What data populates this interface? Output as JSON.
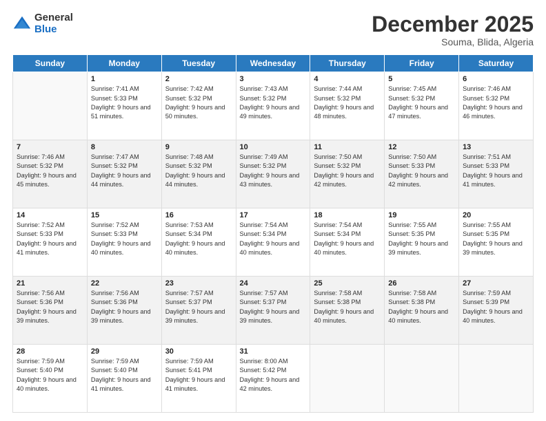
{
  "header": {
    "logo_general": "General",
    "logo_blue": "Blue",
    "main_title": "December 2025",
    "subtitle": "Souma, Blida, Algeria"
  },
  "weekdays": [
    "Sunday",
    "Monday",
    "Tuesday",
    "Wednesday",
    "Thursday",
    "Friday",
    "Saturday"
  ],
  "weeks": [
    [
      {
        "day": "",
        "sunrise": "",
        "sunset": "",
        "daylight": ""
      },
      {
        "day": "1",
        "sunrise": "Sunrise: 7:41 AM",
        "sunset": "Sunset: 5:33 PM",
        "daylight": "Daylight: 9 hours and 51 minutes."
      },
      {
        "day": "2",
        "sunrise": "Sunrise: 7:42 AM",
        "sunset": "Sunset: 5:32 PM",
        "daylight": "Daylight: 9 hours and 50 minutes."
      },
      {
        "day": "3",
        "sunrise": "Sunrise: 7:43 AM",
        "sunset": "Sunset: 5:32 PM",
        "daylight": "Daylight: 9 hours and 49 minutes."
      },
      {
        "day": "4",
        "sunrise": "Sunrise: 7:44 AM",
        "sunset": "Sunset: 5:32 PM",
        "daylight": "Daylight: 9 hours and 48 minutes."
      },
      {
        "day": "5",
        "sunrise": "Sunrise: 7:45 AM",
        "sunset": "Sunset: 5:32 PM",
        "daylight": "Daylight: 9 hours and 47 minutes."
      },
      {
        "day": "6",
        "sunrise": "Sunrise: 7:46 AM",
        "sunset": "Sunset: 5:32 PM",
        "daylight": "Daylight: 9 hours and 46 minutes."
      }
    ],
    [
      {
        "day": "7",
        "sunrise": "Sunrise: 7:46 AM",
        "sunset": "Sunset: 5:32 PM",
        "daylight": "Daylight: 9 hours and 45 minutes."
      },
      {
        "day": "8",
        "sunrise": "Sunrise: 7:47 AM",
        "sunset": "Sunset: 5:32 PM",
        "daylight": "Daylight: 9 hours and 44 minutes."
      },
      {
        "day": "9",
        "sunrise": "Sunrise: 7:48 AM",
        "sunset": "Sunset: 5:32 PM",
        "daylight": "Daylight: 9 hours and 44 minutes."
      },
      {
        "day": "10",
        "sunrise": "Sunrise: 7:49 AM",
        "sunset": "Sunset: 5:32 PM",
        "daylight": "Daylight: 9 hours and 43 minutes."
      },
      {
        "day": "11",
        "sunrise": "Sunrise: 7:50 AM",
        "sunset": "Sunset: 5:32 PM",
        "daylight": "Daylight: 9 hours and 42 minutes."
      },
      {
        "day": "12",
        "sunrise": "Sunrise: 7:50 AM",
        "sunset": "Sunset: 5:33 PM",
        "daylight": "Daylight: 9 hours and 42 minutes."
      },
      {
        "day": "13",
        "sunrise": "Sunrise: 7:51 AM",
        "sunset": "Sunset: 5:33 PM",
        "daylight": "Daylight: 9 hours and 41 minutes."
      }
    ],
    [
      {
        "day": "14",
        "sunrise": "Sunrise: 7:52 AM",
        "sunset": "Sunset: 5:33 PM",
        "daylight": "Daylight: 9 hours and 41 minutes."
      },
      {
        "day": "15",
        "sunrise": "Sunrise: 7:52 AM",
        "sunset": "Sunset: 5:33 PM",
        "daylight": "Daylight: 9 hours and 40 minutes."
      },
      {
        "day": "16",
        "sunrise": "Sunrise: 7:53 AM",
        "sunset": "Sunset: 5:34 PM",
        "daylight": "Daylight: 9 hours and 40 minutes."
      },
      {
        "day": "17",
        "sunrise": "Sunrise: 7:54 AM",
        "sunset": "Sunset: 5:34 PM",
        "daylight": "Daylight: 9 hours and 40 minutes."
      },
      {
        "day": "18",
        "sunrise": "Sunrise: 7:54 AM",
        "sunset": "Sunset: 5:34 PM",
        "daylight": "Daylight: 9 hours and 40 minutes."
      },
      {
        "day": "19",
        "sunrise": "Sunrise: 7:55 AM",
        "sunset": "Sunset: 5:35 PM",
        "daylight": "Daylight: 9 hours and 39 minutes."
      },
      {
        "day": "20",
        "sunrise": "Sunrise: 7:55 AM",
        "sunset": "Sunset: 5:35 PM",
        "daylight": "Daylight: 9 hours and 39 minutes."
      }
    ],
    [
      {
        "day": "21",
        "sunrise": "Sunrise: 7:56 AM",
        "sunset": "Sunset: 5:36 PM",
        "daylight": "Daylight: 9 hours and 39 minutes."
      },
      {
        "day": "22",
        "sunrise": "Sunrise: 7:56 AM",
        "sunset": "Sunset: 5:36 PM",
        "daylight": "Daylight: 9 hours and 39 minutes."
      },
      {
        "day": "23",
        "sunrise": "Sunrise: 7:57 AM",
        "sunset": "Sunset: 5:37 PM",
        "daylight": "Daylight: 9 hours and 39 minutes."
      },
      {
        "day": "24",
        "sunrise": "Sunrise: 7:57 AM",
        "sunset": "Sunset: 5:37 PM",
        "daylight": "Daylight: 9 hours and 39 minutes."
      },
      {
        "day": "25",
        "sunrise": "Sunrise: 7:58 AM",
        "sunset": "Sunset: 5:38 PM",
        "daylight": "Daylight: 9 hours and 40 minutes."
      },
      {
        "day": "26",
        "sunrise": "Sunrise: 7:58 AM",
        "sunset": "Sunset: 5:38 PM",
        "daylight": "Daylight: 9 hours and 40 minutes."
      },
      {
        "day": "27",
        "sunrise": "Sunrise: 7:59 AM",
        "sunset": "Sunset: 5:39 PM",
        "daylight": "Daylight: 9 hours and 40 minutes."
      }
    ],
    [
      {
        "day": "28",
        "sunrise": "Sunrise: 7:59 AM",
        "sunset": "Sunset: 5:40 PM",
        "daylight": "Daylight: 9 hours and 40 minutes."
      },
      {
        "day": "29",
        "sunrise": "Sunrise: 7:59 AM",
        "sunset": "Sunset: 5:40 PM",
        "daylight": "Daylight: 9 hours and 41 minutes."
      },
      {
        "day": "30",
        "sunrise": "Sunrise: 7:59 AM",
        "sunset": "Sunset: 5:41 PM",
        "daylight": "Daylight: 9 hours and 41 minutes."
      },
      {
        "day": "31",
        "sunrise": "Sunrise: 8:00 AM",
        "sunset": "Sunset: 5:42 PM",
        "daylight": "Daylight: 9 hours and 42 minutes."
      },
      {
        "day": "",
        "sunrise": "",
        "sunset": "",
        "daylight": ""
      },
      {
        "day": "",
        "sunrise": "",
        "sunset": "",
        "daylight": ""
      },
      {
        "day": "",
        "sunrise": "",
        "sunset": "",
        "daylight": ""
      }
    ]
  ]
}
